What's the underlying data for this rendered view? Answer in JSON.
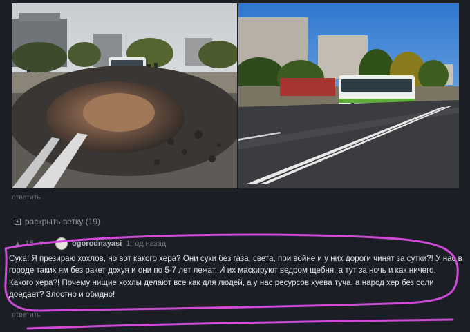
{
  "post": {
    "reply_top": "ответить",
    "expand_thread": "раскрыть ветку (19)"
  },
  "comment": {
    "votes": "▲ 15 ▼",
    "username": "ogorodnayasi",
    "time": "1 год назад",
    "text": "Сука! Я презираю хохлов, но вот какого хера? Они суки без газа, света, при войне и у них дороги чинят за сутки?! У нас в городе таких ям без ракет дохуя и они по 5-7 лет лежат. И их маскируют ведром щебня, а тут за ночь и как ничего. Какого хера?! Почему нищие хохлы делают все как для людей, а у нас ресурсов хуева туча, а народ хер без соли доедает? Злостно и обидно!",
    "reply": "ответить"
  },
  "colors": {
    "background": "#1b1e24",
    "highlight_circle": "#d04ad8",
    "link": "#6d7480"
  },
  "icons": {
    "expand": "plus-box-icon",
    "avatar": "user-avatar"
  }
}
